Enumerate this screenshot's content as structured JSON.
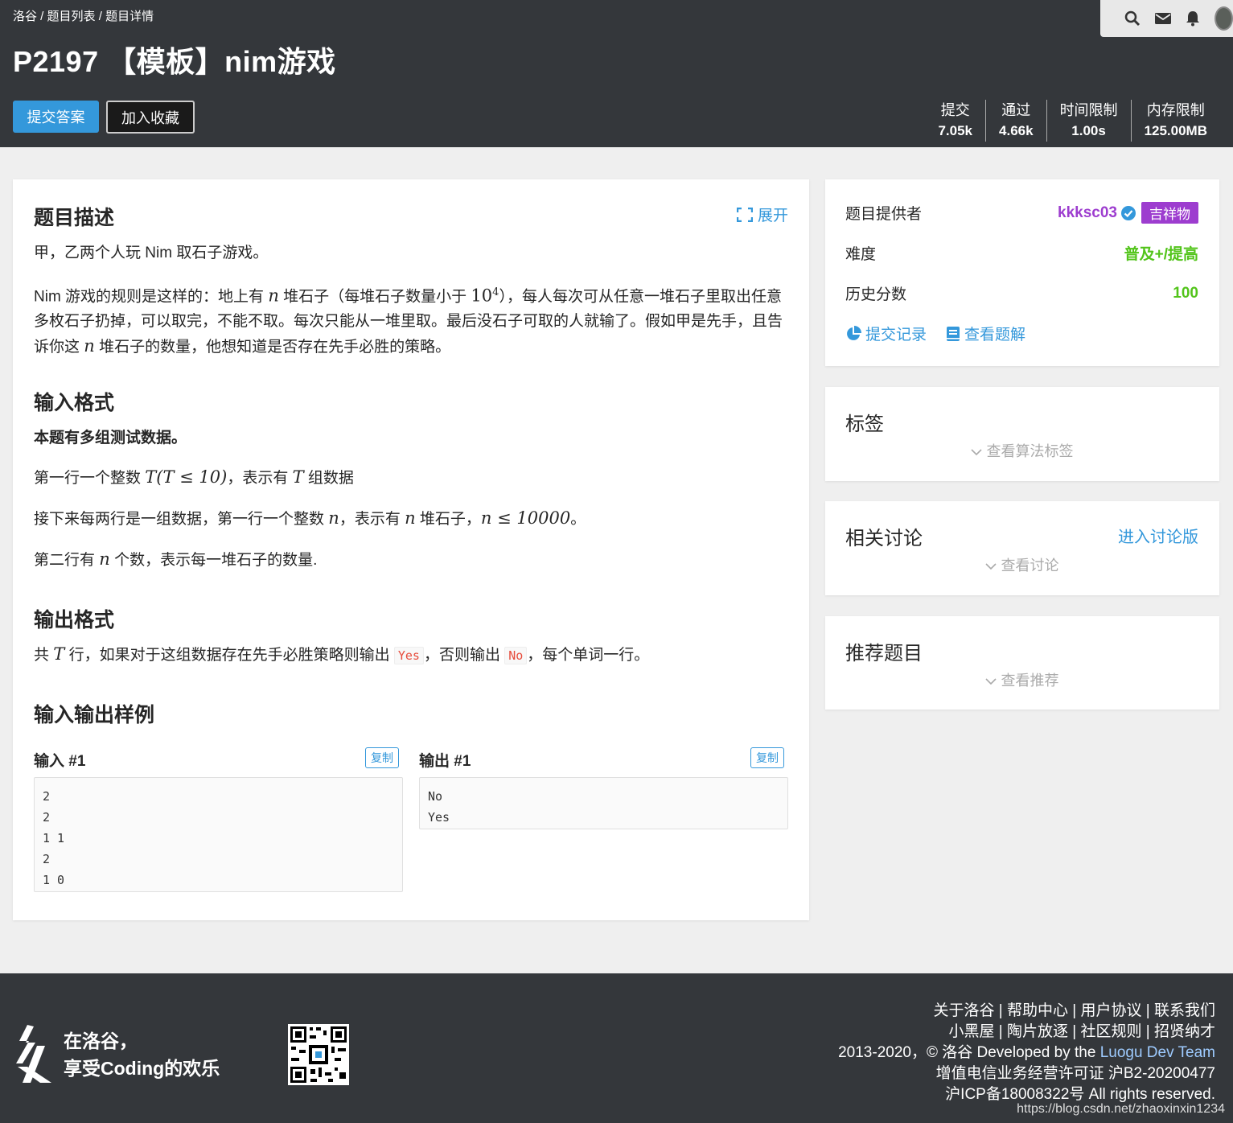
{
  "breadcrumb": {
    "items": [
      "洛谷",
      "题目列表",
      "题目详情"
    ],
    "sep": " / "
  },
  "problem": {
    "title": "P2197 【模板】nim游戏"
  },
  "buttons": {
    "submit": "提交答案",
    "favorite": "加入收藏",
    "expand": "展开"
  },
  "stats": [
    {
      "label": "提交",
      "value": "7.05k"
    },
    {
      "label": "通过",
      "value": "4.66k"
    },
    {
      "label": "时间限制",
      "value": "1.00s"
    },
    {
      "label": "内存限制",
      "value": "125.00MB"
    }
  ],
  "sections": {
    "description": {
      "title": "题目描述",
      "p1": "甲，乙两个人玩 Nim 取石子游戏。",
      "p2a": "Nim 游戏的规则是这样的：地上有 ",
      "p2b": " 堆石子（每堆石子数量小于 ",
      "p2c": "），每人每次可从任意一堆石子里取出任意多枚石子扔掉，可以取完，不能不取。每次只能从一堆里取。最后没石子可取的人就输了。假如甲是先手，且告诉你这 ",
      "p2d": " 堆石子的数量，他想知道是否存在先手必胜的策略。"
    },
    "input": {
      "title": "输入格式",
      "bold": "本题有多组测试数据。",
      "l1a": "第一行一个整数 ",
      "l1b": "，表示有 ",
      "l1c": " 组数据",
      "l2a": "接下来每两行是一组数据，第一行一个整数 ",
      "l2b": "，表示有 ",
      "l2c": " 堆石子，",
      "l2d": "。",
      "l3a": "第二行有 ",
      "l3b": " 个数，表示每一堆石子的数量."
    },
    "output": {
      "title": "输出格式",
      "a": "共 ",
      "b": " 行，如果对于这组数据存在先手必胜策略则输出 ",
      "yes": "Yes",
      "c": "，否则输出 ",
      "no": "No",
      "d": "，每个单词一行。"
    },
    "samples": {
      "title": "输入输出样例",
      "input_label": "输入 #1",
      "output_label": "输出 #1",
      "copy": "复制",
      "input": "2\n2\n1 1\n2\n1 0",
      "output": "No\nYes"
    }
  },
  "math": {
    "n": "n",
    "T": "T",
    "ten": "10",
    "exp": "4",
    "Tcond": "T(T ≤ 10)",
    "ncond": "n ≤ 10000"
  },
  "sidebar": {
    "provider_label": "题目提供者",
    "provider": "kkksc03",
    "provider_tag": "吉祥物",
    "difficulty_label": "难度",
    "difficulty": "普及+/提高",
    "history_label": "历史分数",
    "history": "100",
    "records": "提交记录",
    "solutions": "查看题解",
    "tags_title": "标签",
    "tags_sub": "查看算法标签",
    "discuss_title": "相关讨论",
    "discuss_link": "进入讨论版",
    "discuss_sub": "查看讨论",
    "rec_title": "推荐题目",
    "rec_sub": "查看推荐"
  },
  "footer": {
    "slogan1": "在洛谷，",
    "slogan2": "享受Coding的欢乐",
    "links1": "关于洛谷 | 帮助中心 | 用户协议 | 联系我们",
    "links2": "小黑屋 | 陶片放逐 | 社区规则 | 招贤纳才",
    "copy1": "2013-2020，© 洛谷 Developed by the ",
    "team": "Luogu Dev Team",
    "license": "增值电信业务经营许可证 沪B2-20200477",
    "icp": "沪ICP备18008322号 All rights reserved.",
    "watermark": "https://blog.csdn.net/zhaoxinxin1234"
  },
  "colors": {
    "header": "#34373b",
    "accent": "#3498db",
    "purple": "#9d3dcf",
    "green": "#52c41a"
  }
}
